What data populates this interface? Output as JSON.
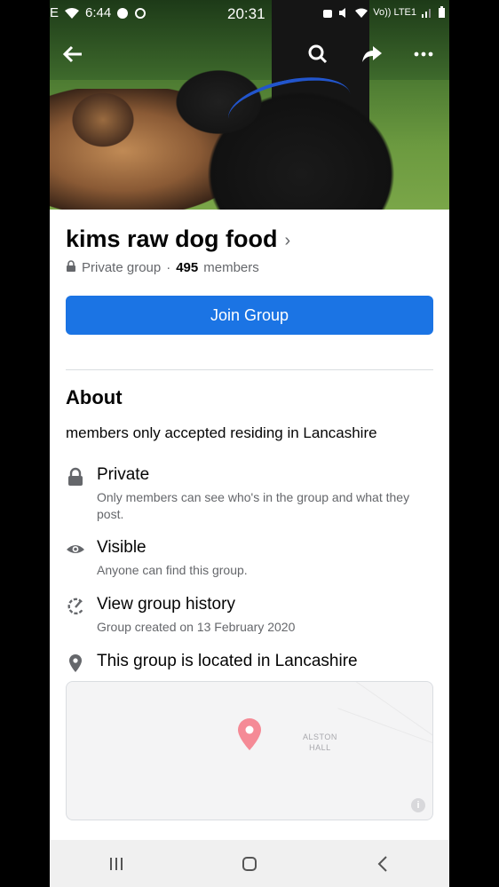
{
  "status_bar": {
    "time": "6:44",
    "center_time": "20:31",
    "net_label": "Vo)) LTE1"
  },
  "cover": {
    "icons": [
      "back-arrow-icon",
      "search-icon",
      "share-icon",
      "more-icon"
    ]
  },
  "group": {
    "name": "kims raw dog food",
    "privacy": "Private group",
    "separator": "·",
    "member_count": "495",
    "members_label": "members"
  },
  "join_button": "Join Group",
  "about": {
    "title": "About",
    "description": "members only accepted residing in Lancashire",
    "items": [
      {
        "icon": "lock-icon",
        "title": "Private",
        "subtitle": "Only members can see who's in the group and what they post."
      },
      {
        "icon": "eye-icon",
        "title": "Visible",
        "subtitle": "Anyone can find this group."
      },
      {
        "icon": "history-icon",
        "title": "View group history",
        "subtitle": "Group created on 13 February 2020"
      },
      {
        "icon": "location-pin-icon",
        "title": "This group is located in Lancashire",
        "subtitle": ""
      }
    ]
  },
  "map": {
    "place_line1": "ALSTON",
    "place_line2": "HALL",
    "info": "i"
  },
  "colors": {
    "primary": "#1b74e4",
    "text": "#050505",
    "secondary_text": "#65676b",
    "pin": "#f0707f"
  }
}
